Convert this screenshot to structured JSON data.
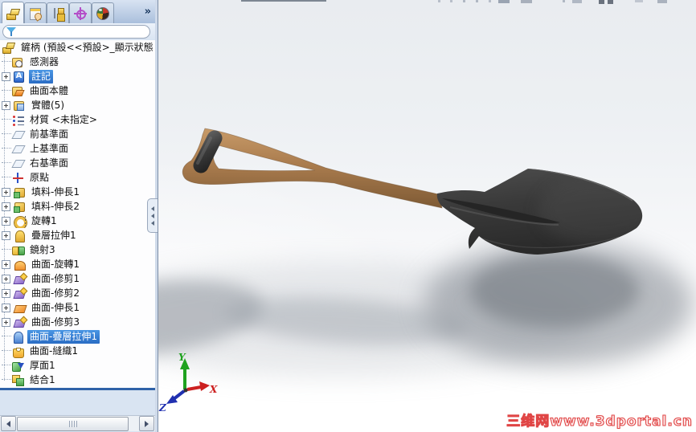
{
  "app": {
    "name": "SolidWorks part document"
  },
  "colors": {
    "selection": "#2e7cd8",
    "splitter_blue": "#2f62a8",
    "handle_wood": "#a97c50",
    "grip_black": "#2f2f2f",
    "blade_gray": "#3a3a3a",
    "watermark_red": "#e04545"
  },
  "panel": {
    "tabs": [
      {
        "name": "featuremanager",
        "active": true
      },
      {
        "name": "propertymanager",
        "active": false
      },
      {
        "name": "configurationmanager",
        "active": false
      },
      {
        "name": "dimxpertmanager",
        "active": false
      },
      {
        "name": "displaymanager",
        "active": false
      }
    ],
    "overflow_button": "»",
    "filter": {
      "value": ""
    },
    "tree": {
      "root": {
        "label": "鏟柄 (預設<<預設>_顯示狀態",
        "icon": "part"
      },
      "items": [
        {
          "label": "感測器",
          "icon": "sensors",
          "expandable": false,
          "selected": false
        },
        {
          "label": "註記",
          "icon": "annotations",
          "expandable": true,
          "selected": true
        },
        {
          "label": "曲面本體",
          "icon": "surface-bodies",
          "expandable": false,
          "selected": false
        },
        {
          "label": "實體(5)",
          "icon": "solid-bodies",
          "expandable": true,
          "selected": false
        },
        {
          "label": "材質 <未指定>",
          "icon": "material",
          "expandable": false,
          "selected": false
        },
        {
          "label": "前基準面",
          "icon": "plane",
          "expandable": false,
          "selected": false
        },
        {
          "label": "上基準面",
          "icon": "plane",
          "expandable": false,
          "selected": false
        },
        {
          "label": "右基準面",
          "icon": "plane",
          "expandable": false,
          "selected": false
        },
        {
          "label": "原點",
          "icon": "origin",
          "expandable": false,
          "selected": false
        },
        {
          "label": "填料-伸長1",
          "icon": "boss-extrude",
          "expandable": true,
          "selected": false
        },
        {
          "label": "填料-伸長2",
          "icon": "boss-extrude",
          "expandable": true,
          "selected": false
        },
        {
          "label": "旋轉1",
          "icon": "revolve",
          "expandable": true,
          "selected": false
        },
        {
          "label": "疊層拉伸1",
          "icon": "loft",
          "expandable": true,
          "selected": false
        },
        {
          "label": "鏡射3",
          "icon": "mirror",
          "expandable": false,
          "selected": false
        },
        {
          "label": "曲面-旋轉1",
          "icon": "surface-revolve",
          "expandable": true,
          "selected": false
        },
        {
          "label": "曲面-修剪1",
          "icon": "surface-trim",
          "expandable": true,
          "selected": false
        },
        {
          "label": "曲面-修剪2",
          "icon": "surface-trim",
          "expandable": true,
          "selected": false
        },
        {
          "label": "曲面-伸長1",
          "icon": "surface-extrude",
          "expandable": true,
          "selected": false
        },
        {
          "label": "曲面-修剪3",
          "icon": "surface-trim",
          "expandable": true,
          "selected": false
        },
        {
          "label": "曲面-疊層拉伸1",
          "icon": "surface-loft",
          "expandable": false,
          "selected": true
        },
        {
          "label": "曲面-縫織1",
          "icon": "surface-knit",
          "expandable": false,
          "selected": false
        },
        {
          "label": "厚面1",
          "icon": "thicken",
          "expandable": false,
          "selected": false
        },
        {
          "label": "結合1",
          "icon": "combine",
          "expandable": false,
          "selected": false
        }
      ]
    }
  },
  "viewport": {
    "model": {
      "name": "shovel",
      "parts": [
        "grip",
        "wood-handle",
        "blade"
      ]
    },
    "triad": {
      "x_label": "X",
      "y_label": "Y",
      "z_label": "Z",
      "x_color": "#cc2020",
      "y_color": "#1fa21f",
      "z_color": "#2030b0"
    },
    "watermark": {
      "text": "三维网www.3dportal.cn"
    }
  }
}
